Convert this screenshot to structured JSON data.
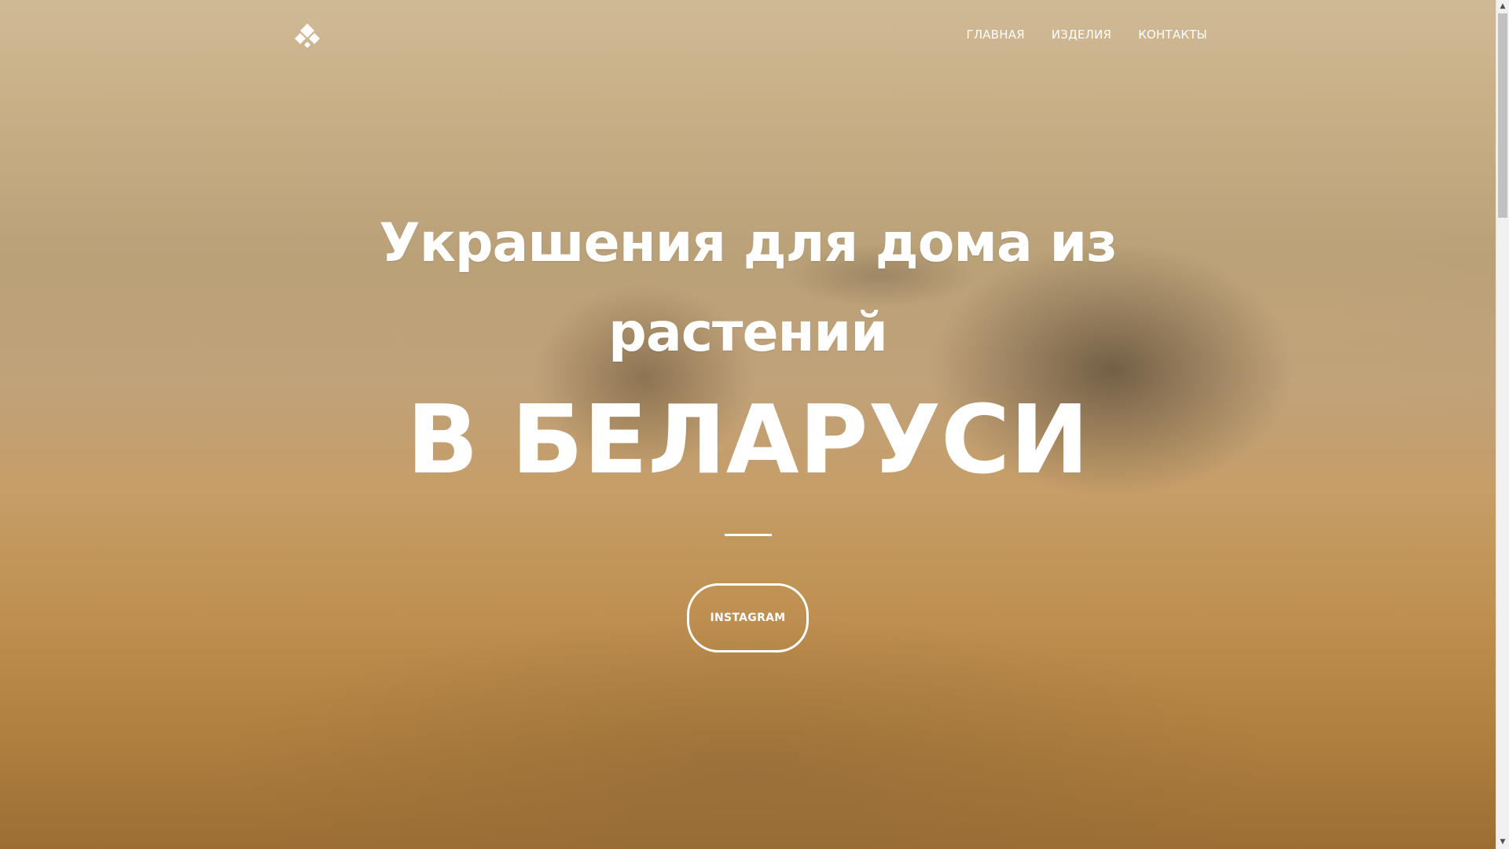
{
  "nav": {
    "logo_icon": "diamond-leaf-logo-icon",
    "items": [
      {
        "label": "ГЛАВНАЯ"
      },
      {
        "label": "ИЗДЕЛИЯ"
      },
      {
        "label": "КОНТАКТЫ"
      }
    ]
  },
  "hero": {
    "subtitle_line1": "Украшения для дома из",
    "subtitle_line2": "растений",
    "title": "В БЕЛАРУСИ",
    "button_label": "INSTAGRAM",
    "background_image": "blurred-hay-bales-field-photo"
  },
  "colors": {
    "text": "#ffffff",
    "background_top": "#c9b28d",
    "background_bottom": "#a47438",
    "scrollbar_track": "#f1f1f1",
    "scrollbar_thumb": "#c1c1c1"
  }
}
